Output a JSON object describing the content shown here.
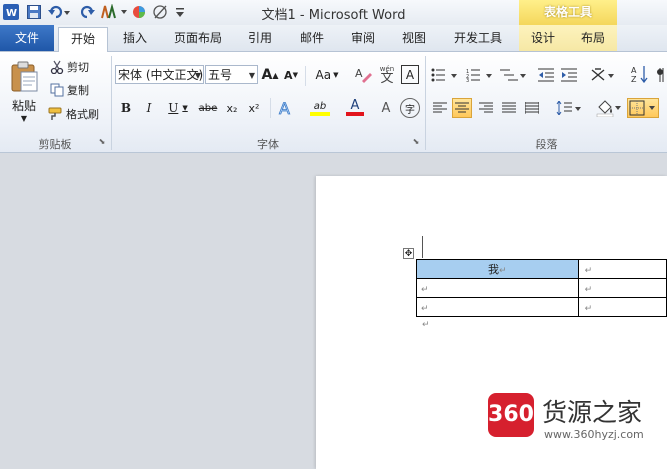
{
  "window": {
    "title": "文档1 - Microsoft Word",
    "contextual_tab_group": "表格工具"
  },
  "tabs": [
    "文件",
    "开始",
    "插入",
    "页面布局",
    "引用",
    "邮件",
    "审阅",
    "视图",
    "开发工具",
    "设计",
    "布局"
  ],
  "clipboard": {
    "paste": "粘贴",
    "cut": "剪切",
    "copy": "复制",
    "format_painter": "格式刷",
    "group_label": "剪贴板"
  },
  "font": {
    "font_name": "宋体 (中文正文)",
    "font_size": "五号",
    "group_label": "字体",
    "bold": "B",
    "italic": "I",
    "underline": "U",
    "strike": "abe",
    "subscript": "x₂",
    "superscript": "x²",
    "grow": "A",
    "shrink": "A",
    "change_case": "Aa",
    "highlight": "ab",
    "font_color": "A",
    "phonetic": "wén",
    "border_char": "A",
    "enclose": "字"
  },
  "paragraph": {
    "group_label": "段落"
  },
  "document": {
    "table": [
      [
        "我",
        ""
      ],
      [
        "",
        ""
      ],
      [
        "",
        ""
      ]
    ],
    "para_mark": "↵"
  },
  "watermark": {
    "logo": "360",
    "title": "货源之家",
    "url": "www.360hyzj.com"
  },
  "colors": {
    "file_tab": "#2a63b5",
    "highlight_yellow": "#ffff00",
    "font_red": "#e2141c",
    "selection": "#a7cef0"
  }
}
